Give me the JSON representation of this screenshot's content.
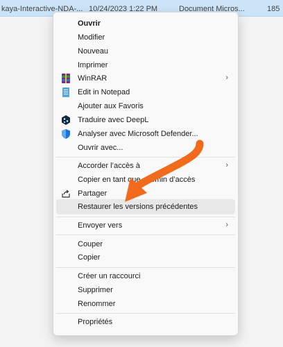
{
  "file_row": {
    "name": "kaya-Interactive-NDA-...",
    "date": "10/24/2023 1:22 PM",
    "type": "Document Micros...",
    "size": "185"
  },
  "menu": {
    "items": [
      {
        "label": "Ouvrir"
      },
      {
        "label": "Modifier"
      },
      {
        "label": "Nouveau"
      },
      {
        "label": "Imprimer"
      },
      {
        "label": "WinRAR"
      },
      {
        "label": "Edit in Notepad"
      },
      {
        "label": "Ajouter aux Favoris"
      },
      {
        "label": "Traduire avec DeepL"
      },
      {
        "label": "Analyser avec Microsoft Defender..."
      },
      {
        "label": "Ouvrir avec..."
      },
      {
        "label": "Accorder l’accès à"
      },
      {
        "label": "Copier en tant que chemin d’accès"
      },
      {
        "label": "Partager"
      },
      {
        "label": "Restaurer les versions précédentes"
      },
      {
        "label": "Envoyer vers"
      },
      {
        "label": "Couper"
      },
      {
        "label": "Copier"
      },
      {
        "label": "Créer un raccourci"
      },
      {
        "label": "Supprimer"
      },
      {
        "label": "Renommer"
      },
      {
        "label": "Propriétés"
      }
    ],
    "submenu_arrow": "›"
  },
  "colors": {
    "selection": "#cce4f7",
    "annotation_arrow": "#f26b1d",
    "defender_blue": "#1a73d9",
    "deepl_navy": "#0f2b46"
  }
}
